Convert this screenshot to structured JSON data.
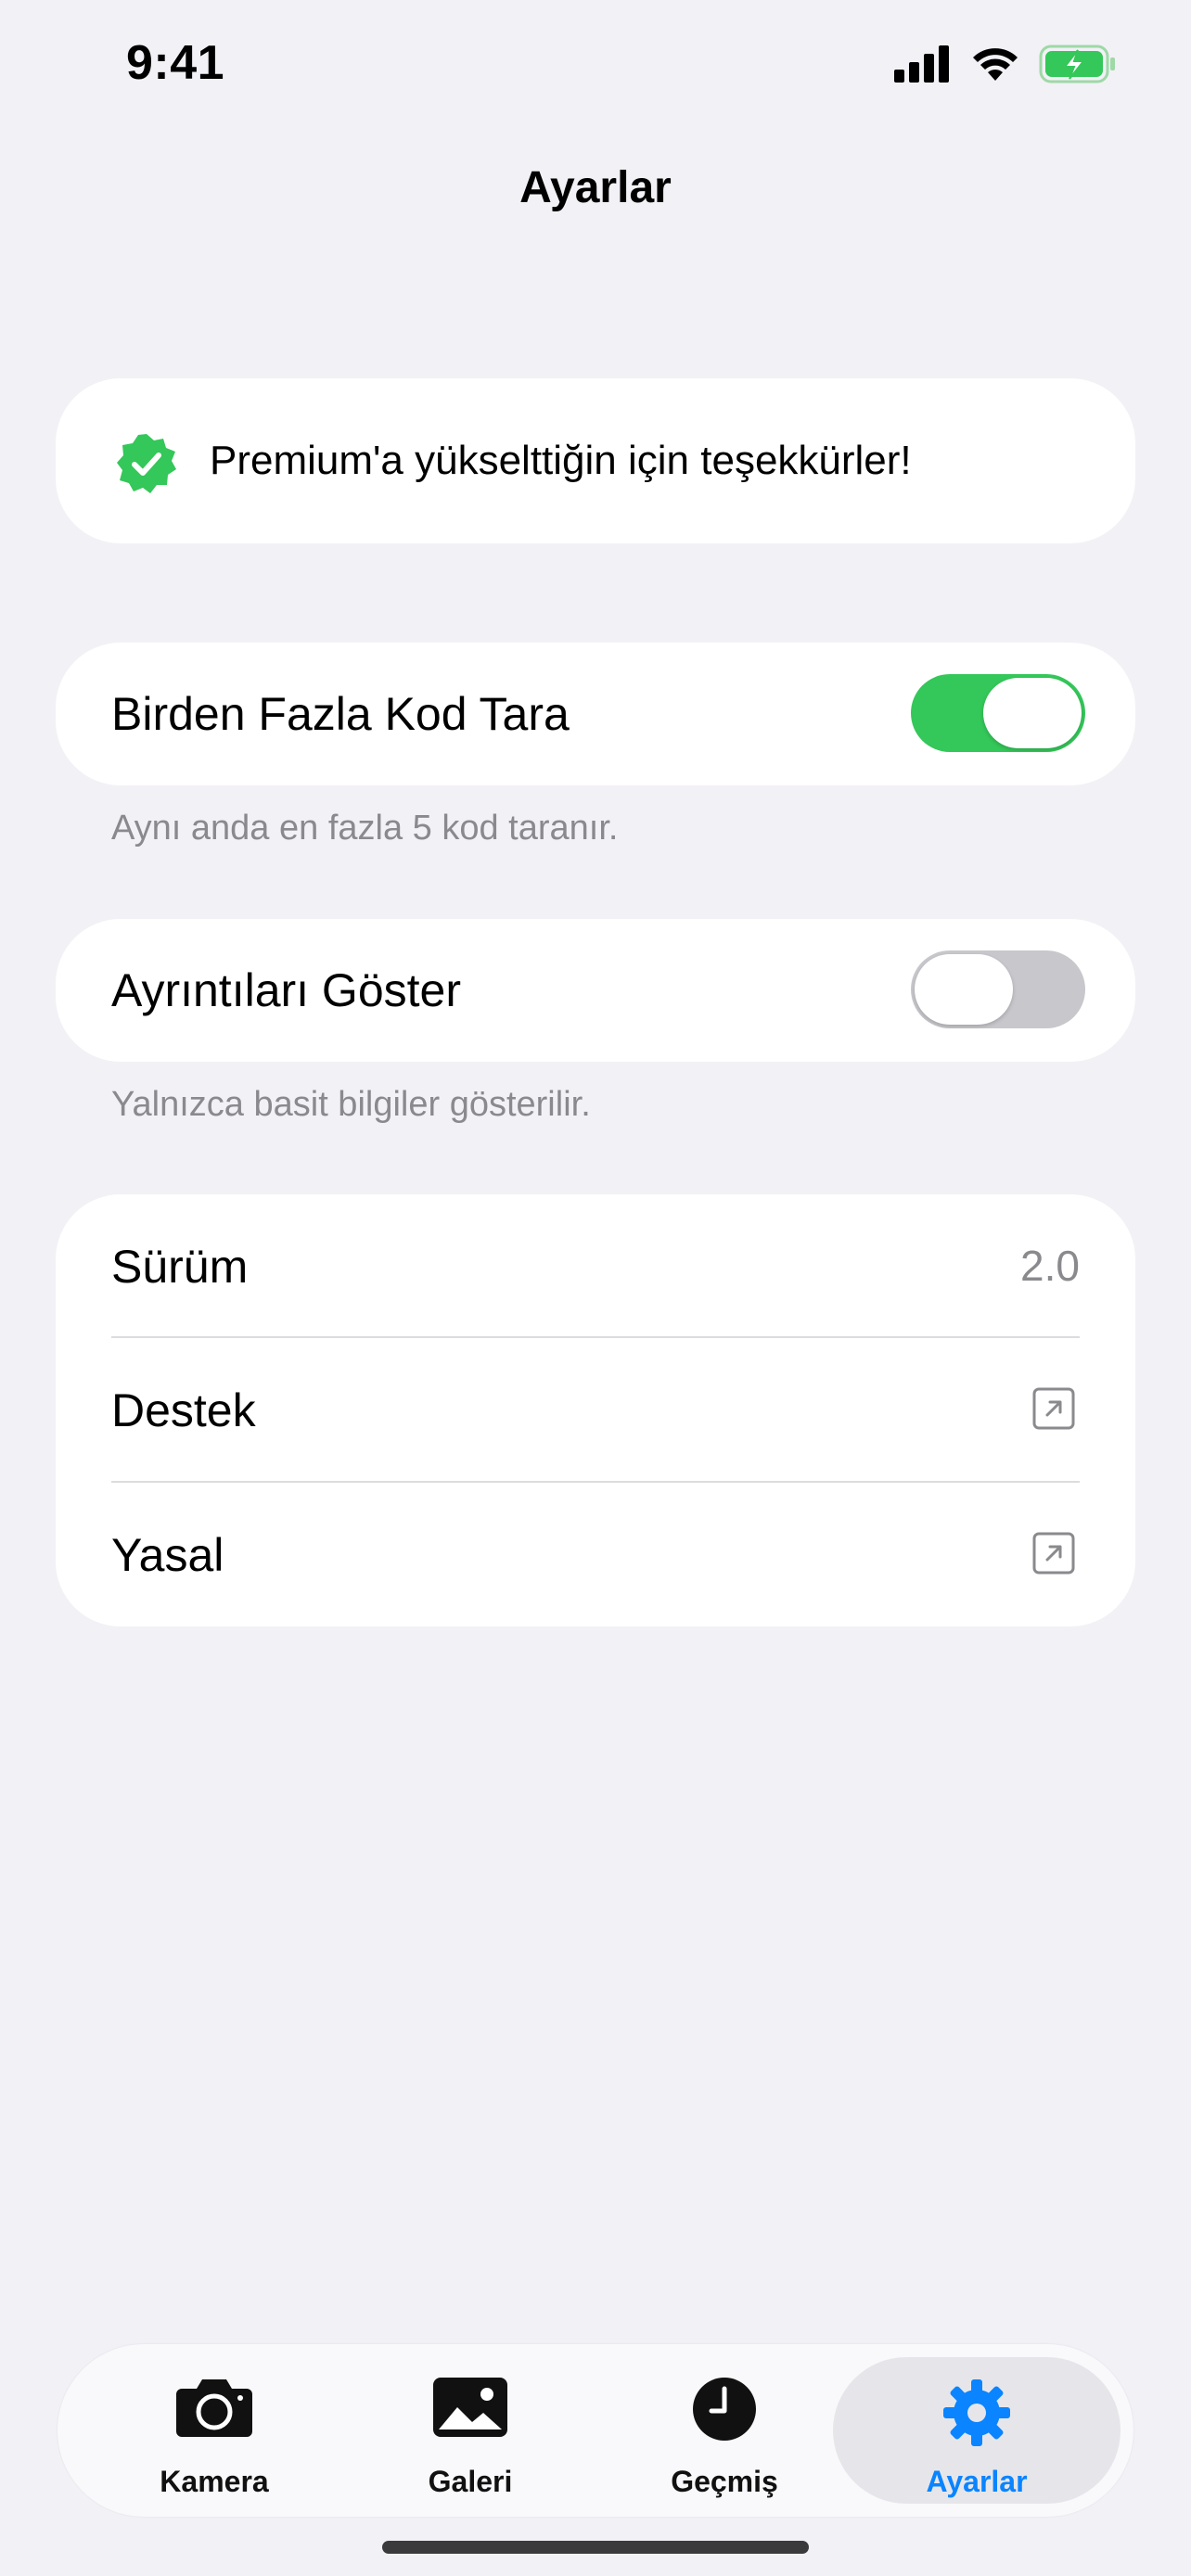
{
  "status_bar": {
    "time": "9:41"
  },
  "nav": {
    "title": "Ayarlar"
  },
  "premium": {
    "message": "Premium'a yükselttiğin için teşekkürler!"
  },
  "settings": {
    "multi_scan": {
      "label": "Birden Fazla Kod Tara",
      "enabled": true,
      "footnote": "Aynı anda en fazla 5 kod taranır."
    },
    "show_details": {
      "label": "Ayrıntıları Göster",
      "enabled": false,
      "footnote": "Yalnızca basit bilgiler gösterilir."
    }
  },
  "info": {
    "version_label": "Sürüm",
    "version_value": "2.0",
    "support_label": "Destek",
    "legal_label": "Yasal"
  },
  "tabbar": {
    "tabs": [
      {
        "label": "Kamera",
        "icon": "camera-icon"
      },
      {
        "label": "Galeri",
        "icon": "photo-icon"
      },
      {
        "label": "Geçmiş",
        "icon": "clock-icon"
      },
      {
        "label": "Ayarlar",
        "icon": "gear-icon",
        "active": true
      }
    ]
  },
  "colors": {
    "accent": "#0a84ff",
    "toggle_on": "#34c759",
    "premium_badge": "#34c759",
    "background": "#f2f1f6"
  }
}
